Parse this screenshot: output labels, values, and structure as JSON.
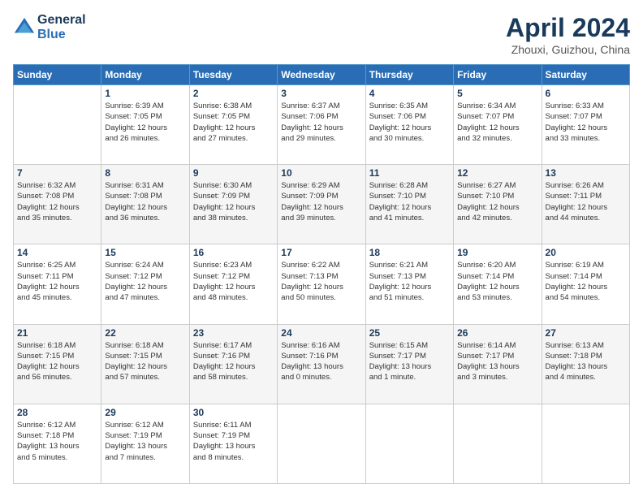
{
  "header": {
    "logo_line1": "General",
    "logo_line2": "Blue",
    "month_title": "April 2024",
    "location": "Zhouxi, Guizhou, China"
  },
  "days_of_week": [
    "Sunday",
    "Monday",
    "Tuesday",
    "Wednesday",
    "Thursday",
    "Friday",
    "Saturday"
  ],
  "weeks": [
    [
      {
        "day": "",
        "info": ""
      },
      {
        "day": "1",
        "info": "Sunrise: 6:39 AM\nSunset: 7:05 PM\nDaylight: 12 hours\nand 26 minutes."
      },
      {
        "day": "2",
        "info": "Sunrise: 6:38 AM\nSunset: 7:05 PM\nDaylight: 12 hours\nand 27 minutes."
      },
      {
        "day": "3",
        "info": "Sunrise: 6:37 AM\nSunset: 7:06 PM\nDaylight: 12 hours\nand 29 minutes."
      },
      {
        "day": "4",
        "info": "Sunrise: 6:35 AM\nSunset: 7:06 PM\nDaylight: 12 hours\nand 30 minutes."
      },
      {
        "day": "5",
        "info": "Sunrise: 6:34 AM\nSunset: 7:07 PM\nDaylight: 12 hours\nand 32 minutes."
      },
      {
        "day": "6",
        "info": "Sunrise: 6:33 AM\nSunset: 7:07 PM\nDaylight: 12 hours\nand 33 minutes."
      }
    ],
    [
      {
        "day": "7",
        "info": "Sunrise: 6:32 AM\nSunset: 7:08 PM\nDaylight: 12 hours\nand 35 minutes."
      },
      {
        "day": "8",
        "info": "Sunrise: 6:31 AM\nSunset: 7:08 PM\nDaylight: 12 hours\nand 36 minutes."
      },
      {
        "day": "9",
        "info": "Sunrise: 6:30 AM\nSunset: 7:09 PM\nDaylight: 12 hours\nand 38 minutes."
      },
      {
        "day": "10",
        "info": "Sunrise: 6:29 AM\nSunset: 7:09 PM\nDaylight: 12 hours\nand 39 minutes."
      },
      {
        "day": "11",
        "info": "Sunrise: 6:28 AM\nSunset: 7:10 PM\nDaylight: 12 hours\nand 41 minutes."
      },
      {
        "day": "12",
        "info": "Sunrise: 6:27 AM\nSunset: 7:10 PM\nDaylight: 12 hours\nand 42 minutes."
      },
      {
        "day": "13",
        "info": "Sunrise: 6:26 AM\nSunset: 7:11 PM\nDaylight: 12 hours\nand 44 minutes."
      }
    ],
    [
      {
        "day": "14",
        "info": "Sunrise: 6:25 AM\nSunset: 7:11 PM\nDaylight: 12 hours\nand 45 minutes."
      },
      {
        "day": "15",
        "info": "Sunrise: 6:24 AM\nSunset: 7:12 PM\nDaylight: 12 hours\nand 47 minutes."
      },
      {
        "day": "16",
        "info": "Sunrise: 6:23 AM\nSunset: 7:12 PM\nDaylight: 12 hours\nand 48 minutes."
      },
      {
        "day": "17",
        "info": "Sunrise: 6:22 AM\nSunset: 7:13 PM\nDaylight: 12 hours\nand 50 minutes."
      },
      {
        "day": "18",
        "info": "Sunrise: 6:21 AM\nSunset: 7:13 PM\nDaylight: 12 hours\nand 51 minutes."
      },
      {
        "day": "19",
        "info": "Sunrise: 6:20 AM\nSunset: 7:14 PM\nDaylight: 12 hours\nand 53 minutes."
      },
      {
        "day": "20",
        "info": "Sunrise: 6:19 AM\nSunset: 7:14 PM\nDaylight: 12 hours\nand 54 minutes."
      }
    ],
    [
      {
        "day": "21",
        "info": "Sunrise: 6:18 AM\nSunset: 7:15 PM\nDaylight: 12 hours\nand 56 minutes."
      },
      {
        "day": "22",
        "info": "Sunrise: 6:18 AM\nSunset: 7:15 PM\nDaylight: 12 hours\nand 57 minutes."
      },
      {
        "day": "23",
        "info": "Sunrise: 6:17 AM\nSunset: 7:16 PM\nDaylight: 12 hours\nand 58 minutes."
      },
      {
        "day": "24",
        "info": "Sunrise: 6:16 AM\nSunset: 7:16 PM\nDaylight: 13 hours\nand 0 minutes."
      },
      {
        "day": "25",
        "info": "Sunrise: 6:15 AM\nSunset: 7:17 PM\nDaylight: 13 hours\nand 1 minute."
      },
      {
        "day": "26",
        "info": "Sunrise: 6:14 AM\nSunset: 7:17 PM\nDaylight: 13 hours\nand 3 minutes."
      },
      {
        "day": "27",
        "info": "Sunrise: 6:13 AM\nSunset: 7:18 PM\nDaylight: 13 hours\nand 4 minutes."
      }
    ],
    [
      {
        "day": "28",
        "info": "Sunrise: 6:12 AM\nSunset: 7:18 PM\nDaylight: 13 hours\nand 5 minutes."
      },
      {
        "day": "29",
        "info": "Sunrise: 6:12 AM\nSunset: 7:19 PM\nDaylight: 13 hours\nand 7 minutes."
      },
      {
        "day": "30",
        "info": "Sunrise: 6:11 AM\nSunset: 7:19 PM\nDaylight: 13 hours\nand 8 minutes."
      },
      {
        "day": "",
        "info": ""
      },
      {
        "day": "",
        "info": ""
      },
      {
        "day": "",
        "info": ""
      },
      {
        "day": "",
        "info": ""
      }
    ]
  ]
}
